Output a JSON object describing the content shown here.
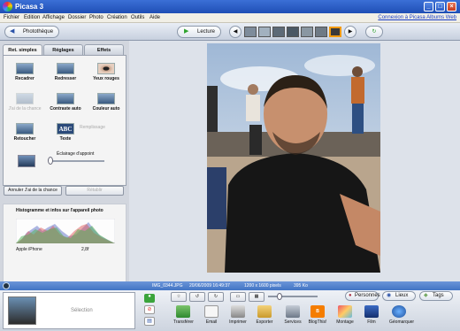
{
  "window": {
    "title": "Picasa 3",
    "minimize": "_",
    "maximize": "□",
    "close": "×"
  },
  "menu": {
    "items": [
      "Fichier",
      "Edition",
      "Affichage",
      "Dossier",
      "Photo",
      "Création",
      "Outils",
      "Aide"
    ],
    "link": "Connexion à Picasa Albums Web"
  },
  "toolbar": {
    "library": "Photothèque",
    "play": "Lecture"
  },
  "tabs": [
    "Ret. simples",
    "Réglages",
    "Effets"
  ],
  "tools": {
    "recadrer": "Recadrer",
    "redresser": "Redresser",
    "yeux": "Yeux rouges",
    "chance": "J'ai de la chance",
    "contraste": "Contraste auto",
    "couleur": "Couleur auto",
    "retoucher": "Retoucher",
    "texte": "Texte",
    "remplissage": "Remplissage",
    "eclairage": "Éclairage d'appoint"
  },
  "actions": {
    "undo": "Annuler J'ai de la chance",
    "redo": "Rétablir"
  },
  "histogram": {
    "title": "Histogramme et infos sur l'appareil photo",
    "camera": "Apple iPhone",
    "aperture": "2,8f"
  },
  "info": {
    "filename": "IMG_0344.JPG",
    "date": "20/06/2009 16:49:37",
    "size": "1200 x 1600 pixels",
    "filesize": "395 Ko"
  },
  "tagbuttons": {
    "personnes": "Personnes",
    "lieux": "Lieux",
    "tags": "Tags"
  },
  "selection": "Sélection",
  "bottom": {
    "transferer": "Transférer",
    "email": "Email",
    "imprimer": "Imprimer",
    "exporter": "Exporter",
    "services": "Services",
    "blogthis": "BlogThis!",
    "montage": "Montage",
    "film": "Film",
    "geomarquer": "Géomarquer"
  },
  "colors": {
    "titlebar": "#2a5dc8",
    "infobar": "#5885d0",
    "accent_play": "#2ea32e"
  }
}
